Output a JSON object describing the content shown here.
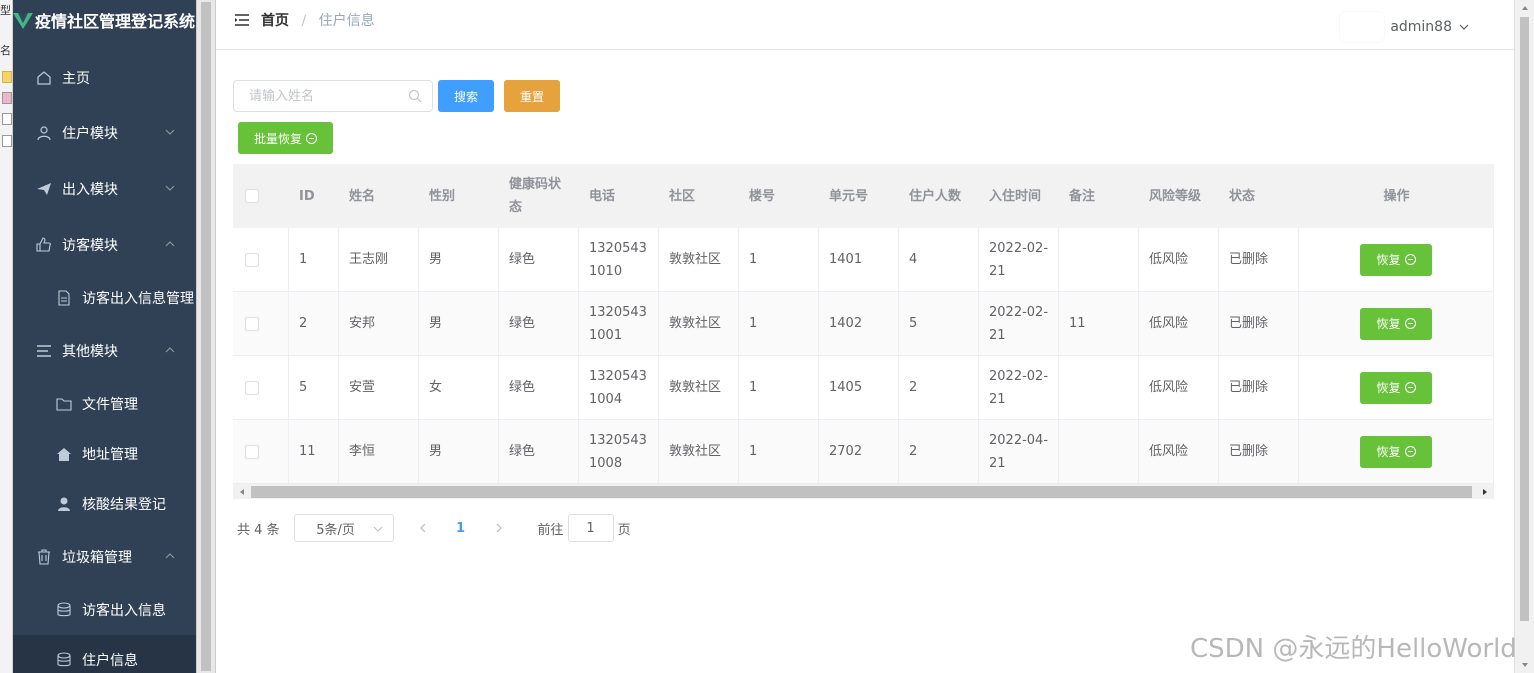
{
  "app": {
    "title": "疫情社区管理登记系统",
    "accent": "#409eff"
  },
  "os_strip": {
    "chars": [
      "型",
      "名"
    ]
  },
  "sidebar": {
    "items": [
      {
        "label": "主页",
        "icon": "home-icon"
      },
      {
        "label": "住户模块",
        "icon": "user-icon"
      },
      {
        "label": "出入模块",
        "icon": "send-icon"
      },
      {
        "label": "访客模块",
        "icon": "thumb-icon"
      },
      {
        "label": "访客出入信息管理",
        "icon": "document-icon"
      },
      {
        "label": "其他模块",
        "icon": "list-icon"
      },
      {
        "label": "文件管理",
        "icon": "folder-icon"
      },
      {
        "label": "地址管理",
        "icon": "house-icon"
      },
      {
        "label": "核酸结果登记",
        "icon": "person-icon"
      },
      {
        "label": "垃圾箱管理",
        "icon": "trash-icon"
      },
      {
        "label": "访客出入信息",
        "icon": "database-icon"
      },
      {
        "label": "住户信息",
        "icon": "database-icon"
      }
    ]
  },
  "navbar": {
    "breadcrumb": {
      "home": "首页",
      "sep": "/",
      "current": "住户信息"
    },
    "username": "admin88"
  },
  "search": {
    "placeholder": "请输入姓名",
    "value": "",
    "search_label": "搜索",
    "reset_label": "重置",
    "batch_restore_label": "批量恢复"
  },
  "table": {
    "headers": {
      "id": "ID",
      "name": "姓名",
      "sex": "性别",
      "health": "健康码状态",
      "phone": "电话",
      "community": "社区",
      "building": "楼号",
      "unit": "单元号",
      "count": "住户人数",
      "date": "入住时间",
      "note": "备注",
      "risk": "风险等级",
      "status": "状态",
      "op": "操作"
    },
    "rows": [
      {
        "id": "1",
        "name": "王志刚",
        "sex": "男",
        "health": "绿色",
        "phone": "13205431010",
        "community": "敦敦社区",
        "building": "1",
        "unit": "1401",
        "count": "4",
        "date": "2022-02-21",
        "note": "",
        "risk": "低风险",
        "status": "已删除",
        "op": "恢复"
      },
      {
        "id": "2",
        "name": "安邦",
        "sex": "男",
        "health": "绿色",
        "phone": "13205431001",
        "community": "敦敦社区",
        "building": "1",
        "unit": "1402",
        "count": "5",
        "date": "2022-02-21",
        "note": "11",
        "risk": "低风险",
        "status": "已删除",
        "op": "恢复"
      },
      {
        "id": "5",
        "name": "安萱",
        "sex": "女",
        "health": "绿色",
        "phone": "13205431004",
        "community": "敦敦社区",
        "building": "1",
        "unit": "1405",
        "count": "2",
        "date": "2022-02-21",
        "note": "",
        "risk": "低风险",
        "status": "已删除",
        "op": "恢复"
      },
      {
        "id": "11",
        "name": "李恒",
        "sex": "男",
        "health": "绿色",
        "phone": "13205431008",
        "community": "敦敦社区",
        "building": "1",
        "unit": "2702",
        "count": "2",
        "date": "2022-04-21",
        "note": "",
        "risk": "低风险",
        "status": "已删除",
        "op": "恢复"
      }
    ]
  },
  "pagination": {
    "total": "共 4 条",
    "page_size": "5条/页",
    "current_page": "1",
    "goto_label": "前往",
    "goto_value": "1",
    "page_unit": "页"
  },
  "watermark": "CSDN @永远的HelloWorld"
}
